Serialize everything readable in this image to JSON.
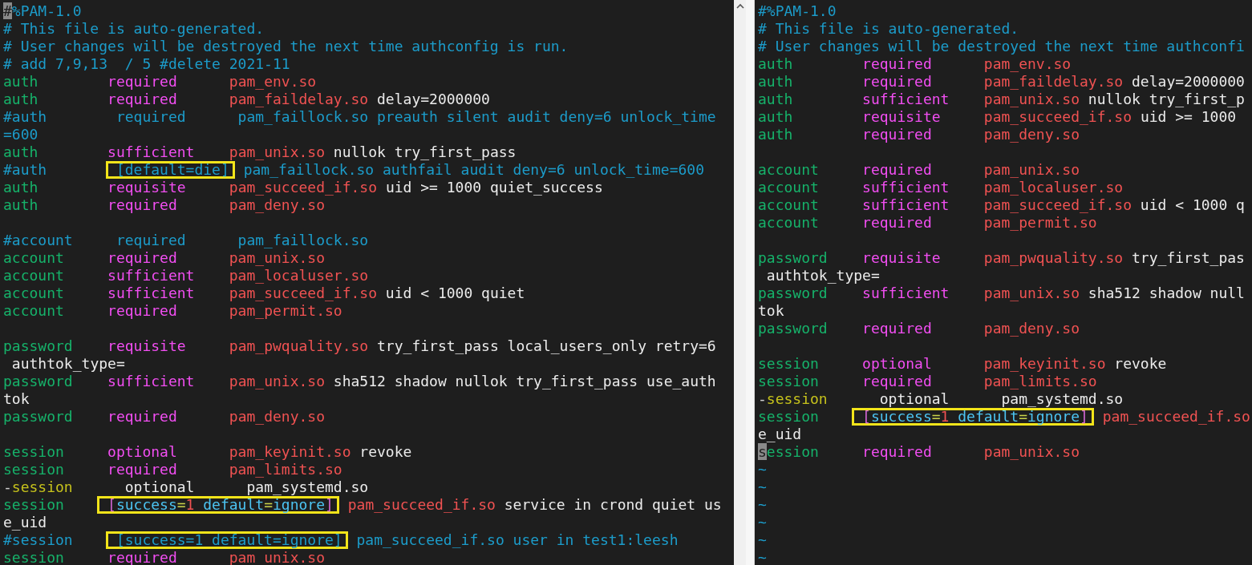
{
  "panes": [
    {
      "lines": [
        {
          "kind": "code",
          "segments": [
            {
              "kind": "cursor",
              "text": "#"
            },
            {
              "kind": "comment",
              "text": "%PAM-1.0"
            }
          ]
        },
        {
          "kind": "code",
          "segments": [
            {
              "kind": "comment",
              "text": "# This file is auto-generated."
            }
          ]
        },
        {
          "kind": "code",
          "segments": [
            {
              "kind": "comment",
              "text": "# User changes will be destroyed the next time authconfig is run."
            }
          ]
        },
        {
          "kind": "code",
          "segments": [
            {
              "kind": "comment",
              "text": "# add 7,9,13  / 5 #delete 2021-11"
            }
          ]
        },
        {
          "kind": "code",
          "segments": [
            {
              "kind": "type",
              "text": "auth        "
            },
            {
              "kind": "control",
              "text": "required      "
            },
            {
              "kind": "module",
              "text": "pam_env.so"
            }
          ]
        },
        {
          "kind": "code",
          "segments": [
            {
              "kind": "type",
              "text": "auth        "
            },
            {
              "kind": "control",
              "text": "required      "
            },
            {
              "kind": "module",
              "text": "pam_faildelay.so"
            },
            {
              "kind": "arg",
              "text": " delay=2000000"
            }
          ]
        },
        {
          "kind": "code",
          "segments": [
            {
              "kind": "comment",
              "text": "#auth        required      pam_faillock.so preauth silent audit deny=6 unlock_time"
            }
          ]
        },
        {
          "kind": "code",
          "segments": [
            {
              "kind": "comment",
              "text": "=600"
            }
          ]
        },
        {
          "kind": "code",
          "segments": [
            {
              "kind": "type",
              "text": "auth        "
            },
            {
              "kind": "control",
              "text": "sufficient    "
            },
            {
              "kind": "module",
              "text": "pam_unix.so"
            },
            {
              "kind": "arg",
              "text": " nullok try_first_pass"
            }
          ]
        },
        {
          "kind": "code",
          "segments": [
            {
              "kind": "comment",
              "text": "#auth        "
            },
            {
              "kind": "box",
              "parts": [
                {
                  "kind": "comment",
                  "text": "[default=die]"
                }
              ]
            },
            {
              "kind": "comment",
              "text": " pam_faillock.so authfail audit deny=6 unlock_time=600"
            }
          ]
        },
        {
          "kind": "code",
          "segments": [
            {
              "kind": "type",
              "text": "auth        "
            },
            {
              "kind": "control",
              "text": "requisite     "
            },
            {
              "kind": "module",
              "text": "pam_succeed_if.so"
            },
            {
              "kind": "arg",
              "text": " uid >= 1000 quiet_success"
            }
          ]
        },
        {
          "kind": "code",
          "segments": [
            {
              "kind": "type",
              "text": "auth        "
            },
            {
              "kind": "control",
              "text": "required      "
            },
            {
              "kind": "module",
              "text": "pam_deny.so"
            }
          ]
        },
        {
          "kind": "blank"
        },
        {
          "kind": "code",
          "segments": [
            {
              "kind": "comment",
              "text": "#account     required      pam_faillock.so"
            }
          ]
        },
        {
          "kind": "code",
          "segments": [
            {
              "kind": "type",
              "text": "account     "
            },
            {
              "kind": "control",
              "text": "required      "
            },
            {
              "kind": "module",
              "text": "pam_unix.so"
            }
          ]
        },
        {
          "kind": "code",
          "segments": [
            {
              "kind": "type",
              "text": "account     "
            },
            {
              "kind": "control",
              "text": "sufficient    "
            },
            {
              "kind": "module",
              "text": "pam_localuser.so"
            }
          ]
        },
        {
          "kind": "code",
          "segments": [
            {
              "kind": "type",
              "text": "account     "
            },
            {
              "kind": "control",
              "text": "sufficient    "
            },
            {
              "kind": "module",
              "text": "pam_succeed_if.so"
            },
            {
              "kind": "arg",
              "text": " uid < 1000 quiet"
            }
          ]
        },
        {
          "kind": "code",
          "segments": [
            {
              "kind": "type",
              "text": "account     "
            },
            {
              "kind": "control",
              "text": "required      "
            },
            {
              "kind": "module",
              "text": "pam_permit.so"
            }
          ]
        },
        {
          "kind": "blank"
        },
        {
          "kind": "code",
          "segments": [
            {
              "kind": "type",
              "text": "password    "
            },
            {
              "kind": "control",
              "text": "requisite     "
            },
            {
              "kind": "module",
              "text": "pam_pwquality.so"
            },
            {
              "kind": "arg",
              "text": " try_first_pass local_users_only retry=6"
            }
          ]
        },
        {
          "kind": "code",
          "segments": [
            {
              "kind": "arg",
              "text": " authtok_type="
            }
          ]
        },
        {
          "kind": "code",
          "segments": [
            {
              "kind": "type",
              "text": "password    "
            },
            {
              "kind": "control",
              "text": "sufficient    "
            },
            {
              "kind": "module",
              "text": "pam_unix.so"
            },
            {
              "kind": "arg",
              "text": " sha512 shadow nullok try_first_pass use_auth"
            }
          ]
        },
        {
          "kind": "code",
          "segments": [
            {
              "kind": "arg",
              "text": "tok"
            }
          ]
        },
        {
          "kind": "code",
          "segments": [
            {
              "kind": "type",
              "text": "password    "
            },
            {
              "kind": "control",
              "text": "required      "
            },
            {
              "kind": "module",
              "text": "pam_deny.so"
            }
          ]
        },
        {
          "kind": "blank"
        },
        {
          "kind": "code",
          "segments": [
            {
              "kind": "type",
              "text": "session     "
            },
            {
              "kind": "control",
              "text": "optional      "
            },
            {
              "kind": "module",
              "text": "pam_keyinit.so"
            },
            {
              "kind": "arg",
              "text": " revoke"
            }
          ]
        },
        {
          "kind": "code",
          "segments": [
            {
              "kind": "type",
              "text": "session     "
            },
            {
              "kind": "control",
              "text": "required      "
            },
            {
              "kind": "module",
              "text": "pam_limits.so"
            }
          ]
        },
        {
          "kind": "code",
          "segments": [
            {
              "kind": "dash",
              "text": "-"
            },
            {
              "kind": "optional_type",
              "text": "session     "
            },
            {
              "kind": "arg",
              "text": " optional      pam_systemd.so"
            }
          ]
        },
        {
          "kind": "code",
          "segments": [
            {
              "kind": "type",
              "text": "session     "
            },
            {
              "kind": "box",
              "parts": [
                {
                  "kind": "bracket",
                  "text": "["
                },
                {
                  "kind": "keyword",
                  "text": "success"
                },
                {
                  "kind": "equals",
                  "text": "="
                },
                {
                  "kind": "number",
                  "text": "1"
                },
                {
                  "kind": "keyword",
                  "text": " default"
                },
                {
                  "kind": "equals",
                  "text": "="
                },
                {
                  "kind": "keyword",
                  "text": "ignore"
                },
                {
                  "kind": "bracket",
                  "text": "]"
                }
              ]
            },
            {
              "kind": "module",
              "text": " pam_succeed_if.so"
            },
            {
              "kind": "arg",
              "text": " service in crond quiet us"
            }
          ]
        },
        {
          "kind": "code",
          "segments": [
            {
              "kind": "arg",
              "text": "e_uid"
            }
          ]
        },
        {
          "kind": "code",
          "segments": [
            {
              "kind": "comment",
              "text": "#session     "
            },
            {
              "kind": "box",
              "parts": [
                {
                  "kind": "comment",
                  "text": "[success=1 default=ignore]"
                }
              ]
            },
            {
              "kind": "comment",
              "text": " pam_succeed_if.so user in test1:leesh"
            }
          ]
        },
        {
          "kind": "code",
          "segments": [
            {
              "kind": "type",
              "text": "session     "
            },
            {
              "kind": "control",
              "text": "required      "
            },
            {
              "kind": "module",
              "text": "pam_unix.so"
            }
          ]
        }
      ]
    },
    {
      "lines": [
        {
          "kind": "code",
          "segments": [
            {
              "kind": "comment",
              "text": "#%PAM-1.0"
            }
          ]
        },
        {
          "kind": "code",
          "segments": [
            {
              "kind": "comment",
              "text": "# This file is auto-generated."
            }
          ]
        },
        {
          "kind": "code",
          "segments": [
            {
              "kind": "comment",
              "text": "# User changes will be destroyed the next time authconfi"
            }
          ]
        },
        {
          "kind": "code",
          "segments": [
            {
              "kind": "type",
              "text": "auth        "
            },
            {
              "kind": "control",
              "text": "required      "
            },
            {
              "kind": "module",
              "text": "pam_env.so"
            }
          ]
        },
        {
          "kind": "code",
          "segments": [
            {
              "kind": "type",
              "text": "auth        "
            },
            {
              "kind": "control",
              "text": "required      "
            },
            {
              "kind": "module",
              "text": "pam_faildelay.so"
            },
            {
              "kind": "arg",
              "text": " delay=2000000"
            }
          ]
        },
        {
          "kind": "code",
          "segments": [
            {
              "kind": "type",
              "text": "auth        "
            },
            {
              "kind": "control",
              "text": "sufficient    "
            },
            {
              "kind": "module",
              "text": "pam_unix.so"
            },
            {
              "kind": "arg",
              "text": " nullok try_first_p"
            }
          ]
        },
        {
          "kind": "code",
          "segments": [
            {
              "kind": "type",
              "text": "auth        "
            },
            {
              "kind": "control",
              "text": "requisite     "
            },
            {
              "kind": "module",
              "text": "pam_succeed_if.so"
            },
            {
              "kind": "arg",
              "text": " uid >= 1000"
            }
          ]
        },
        {
          "kind": "code",
          "segments": [
            {
              "kind": "type",
              "text": "auth        "
            },
            {
              "kind": "control",
              "text": "required      "
            },
            {
              "kind": "module",
              "text": "pam_deny.so"
            }
          ]
        },
        {
          "kind": "blank"
        },
        {
          "kind": "code",
          "segments": [
            {
              "kind": "type",
              "text": "account     "
            },
            {
              "kind": "control",
              "text": "required      "
            },
            {
              "kind": "module",
              "text": "pam_unix.so"
            }
          ]
        },
        {
          "kind": "code",
          "segments": [
            {
              "kind": "type",
              "text": "account     "
            },
            {
              "kind": "control",
              "text": "sufficient    "
            },
            {
              "kind": "module",
              "text": "pam_localuser.so"
            }
          ]
        },
        {
          "kind": "code",
          "segments": [
            {
              "kind": "type",
              "text": "account     "
            },
            {
              "kind": "control",
              "text": "sufficient    "
            },
            {
              "kind": "module",
              "text": "pam_succeed_if.so"
            },
            {
              "kind": "arg",
              "text": " uid < 1000 q"
            }
          ]
        },
        {
          "kind": "code",
          "segments": [
            {
              "kind": "type",
              "text": "account     "
            },
            {
              "kind": "control",
              "text": "required      "
            },
            {
              "kind": "module",
              "text": "pam_permit.so"
            }
          ]
        },
        {
          "kind": "blank"
        },
        {
          "kind": "code",
          "segments": [
            {
              "kind": "type",
              "text": "password    "
            },
            {
              "kind": "control",
              "text": "requisite     "
            },
            {
              "kind": "module",
              "text": "pam_pwquality.so"
            },
            {
              "kind": "arg",
              "text": " try_first_pas"
            }
          ]
        },
        {
          "kind": "code",
          "segments": [
            {
              "kind": "arg",
              "text": " authtok_type="
            }
          ]
        },
        {
          "kind": "code",
          "segments": [
            {
              "kind": "type",
              "text": "password    "
            },
            {
              "kind": "control",
              "text": "sufficient    "
            },
            {
              "kind": "module",
              "text": "pam_unix.so"
            },
            {
              "kind": "arg",
              "text": " sha512 shadow null"
            }
          ]
        },
        {
          "kind": "code",
          "segments": [
            {
              "kind": "arg",
              "text": "tok"
            }
          ]
        },
        {
          "kind": "code",
          "segments": [
            {
              "kind": "type",
              "text": "password    "
            },
            {
              "kind": "control",
              "text": "required      "
            },
            {
              "kind": "module",
              "text": "pam_deny.so"
            }
          ]
        },
        {
          "kind": "blank"
        },
        {
          "kind": "code",
          "segments": [
            {
              "kind": "type",
              "text": "session     "
            },
            {
              "kind": "control",
              "text": "optional      "
            },
            {
              "kind": "module",
              "text": "pam_keyinit.so"
            },
            {
              "kind": "arg",
              "text": " revoke"
            }
          ]
        },
        {
          "kind": "code",
          "segments": [
            {
              "kind": "type",
              "text": "session     "
            },
            {
              "kind": "control",
              "text": "required      "
            },
            {
              "kind": "module",
              "text": "pam_limits.so"
            }
          ]
        },
        {
          "kind": "code",
          "segments": [
            {
              "kind": "dash",
              "text": "-"
            },
            {
              "kind": "optional_type",
              "text": "session     "
            },
            {
              "kind": "arg",
              "text": " optional      pam_systemd.so"
            }
          ]
        },
        {
          "kind": "code",
          "segments": [
            {
              "kind": "type",
              "text": "session     "
            },
            {
              "kind": "box",
              "parts": [
                {
                  "kind": "bracket",
                  "text": "["
                },
                {
                  "kind": "keyword",
                  "text": "success"
                },
                {
                  "kind": "equals",
                  "text": "="
                },
                {
                  "kind": "number",
                  "text": "1"
                },
                {
                  "kind": "keyword",
                  "text": " default"
                },
                {
                  "kind": "equals",
                  "text": "="
                },
                {
                  "kind": "keyword",
                  "text": "ignore"
                },
                {
                  "kind": "bracket",
                  "text": "]"
                }
              ]
            },
            {
              "kind": "module",
              "text": " pam_succeed_if.so"
            }
          ]
        },
        {
          "kind": "code",
          "segments": [
            {
              "kind": "arg",
              "text": "e_uid"
            }
          ]
        },
        {
          "kind": "code",
          "segments": [
            {
              "kind": "cursor",
              "text": "s"
            },
            {
              "kind": "type",
              "text": "ession     "
            },
            {
              "kind": "control",
              "text": "required      "
            },
            {
              "kind": "module",
              "text": "pam_unix.so"
            }
          ]
        },
        {
          "kind": "code",
          "segments": [
            {
              "kind": "tilde",
              "text": "~"
            }
          ]
        },
        {
          "kind": "code",
          "segments": [
            {
              "kind": "tilde",
              "text": "~"
            }
          ]
        },
        {
          "kind": "code",
          "segments": [
            {
              "kind": "tilde",
              "text": "~"
            }
          ]
        },
        {
          "kind": "code",
          "segments": [
            {
              "kind": "tilde",
              "text": "~"
            }
          ]
        },
        {
          "kind": "code",
          "segments": [
            {
              "kind": "tilde",
              "text": "~"
            }
          ]
        },
        {
          "kind": "code",
          "segments": [
            {
              "kind": "tilde",
              "text": "~"
            }
          ]
        }
      ]
    }
  ]
}
